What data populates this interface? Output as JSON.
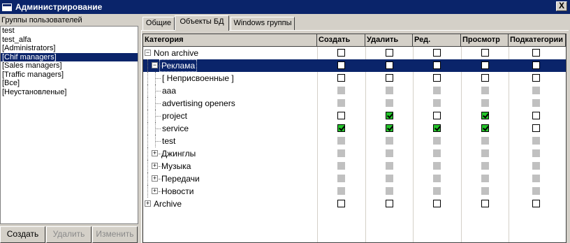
{
  "window": {
    "title": "Администрирование",
    "close_label": "X"
  },
  "groups": {
    "label": "Группы пользователей",
    "items": [
      {
        "label": "test",
        "selected": false
      },
      {
        "label": "test_alfa",
        "selected": false
      },
      {
        "label": "[Administrators]",
        "selected": false
      },
      {
        "label": "[Chif managers]",
        "selected": true
      },
      {
        "label": "[Sales managers]",
        "selected": false
      },
      {
        "label": "[Traffic managers]",
        "selected": false
      },
      {
        "label": "[Все]",
        "selected": false
      },
      {
        "label": "[Неустановленые]",
        "selected": false
      }
    ],
    "buttons": {
      "create": "Создать",
      "delete": "Удалить",
      "edit": "Изменить"
    }
  },
  "tabs": [
    {
      "label": "Общие",
      "active": false
    },
    {
      "label": "Объекты БД",
      "active": true
    },
    {
      "label": "Windows группы",
      "active": false
    }
  ],
  "grid": {
    "columns": [
      "Категория",
      "Создать",
      "Удалить",
      "Ред.",
      "Просмотр",
      "Подкатегории"
    ],
    "rows": [
      {
        "name": "Non archive",
        "level": 0,
        "expander": "minus",
        "selected": false,
        "perms": [
          "u",
          "u",
          "u",
          "u",
          "u"
        ]
      },
      {
        "name": "Реклама",
        "level": 1,
        "expander": "minus",
        "selected": true,
        "perms": [
          "u",
          "u",
          "u",
          "u",
          "u"
        ]
      },
      {
        "name": "[ Неприсвоенные ]",
        "level": 2,
        "expander": "none",
        "selected": false,
        "perms": [
          "u",
          "u",
          "u",
          "u",
          "u"
        ]
      },
      {
        "name": "aaa",
        "level": 2,
        "expander": "none",
        "selected": false,
        "perms": [
          "d",
          "d",
          "d",
          "d",
          "d"
        ]
      },
      {
        "name": "advertising openers",
        "level": 2,
        "expander": "none",
        "selected": false,
        "perms": [
          "d",
          "d",
          "d",
          "d",
          "d"
        ]
      },
      {
        "name": "project",
        "level": 2,
        "expander": "none",
        "selected": false,
        "perms": [
          "u",
          "c",
          "u",
          "c",
          "u"
        ]
      },
      {
        "name": "service",
        "level": 2,
        "expander": "none",
        "selected": false,
        "perms": [
          "c",
          "c",
          "c",
          "c",
          "u"
        ]
      },
      {
        "name": "test",
        "level": 2,
        "expander": "none",
        "selected": false,
        "perms": [
          "d",
          "d",
          "d",
          "d",
          "d"
        ]
      },
      {
        "name": "Джинглы",
        "level": 1,
        "expander": "plus",
        "selected": false,
        "perms": [
          "d",
          "d",
          "d",
          "d",
          "d"
        ]
      },
      {
        "name": "Музыка",
        "level": 1,
        "expander": "plus",
        "selected": false,
        "perms": [
          "d",
          "d",
          "d",
          "d",
          "d"
        ]
      },
      {
        "name": "Передачи",
        "level": 1,
        "expander": "plus",
        "selected": false,
        "perms": [
          "d",
          "d",
          "d",
          "d",
          "d"
        ]
      },
      {
        "name": "Новости",
        "level": 1,
        "expander": "plus",
        "selected": false,
        "perms": [
          "d",
          "d",
          "d",
          "d",
          "d"
        ]
      },
      {
        "name": "Archive",
        "level": 0,
        "expander": "plus",
        "selected": false,
        "perms": [
          "u",
          "u",
          "u",
          "u",
          "u"
        ]
      }
    ],
    "legend": {
      "u": "unchecked",
      "c": "checked",
      "d": "disabled"
    }
  }
}
